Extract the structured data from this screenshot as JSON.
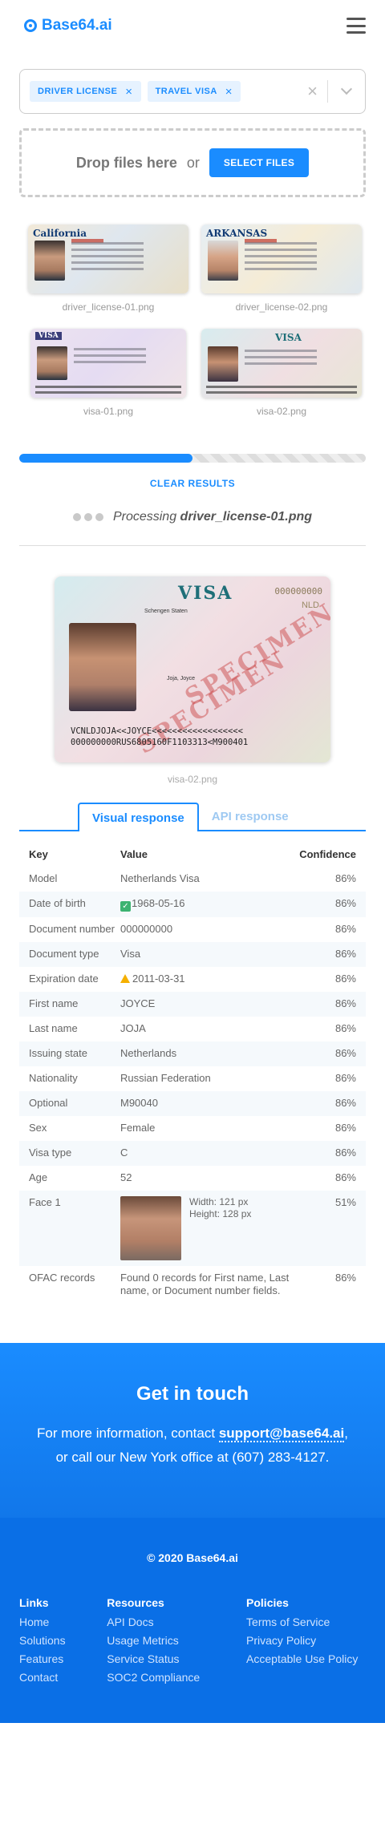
{
  "header": {
    "logo_text": "Base64.ai",
    "menu_icon": "hamburger-menu-icon"
  },
  "select": {
    "chips": [
      {
        "label": "DRIVER LICENSE"
      },
      {
        "label": "TRAVEL VISA"
      }
    ],
    "clear_symbol": "×",
    "chip_remove_symbol": "×"
  },
  "dropzone": {
    "text": "Drop files here",
    "or": "or",
    "button": "SELECT FILES"
  },
  "thumbnails": [
    {
      "caption": "driver_license-01.png",
      "header": "California"
    },
    {
      "caption": "driver_license-02.png",
      "header": "ARKANSAS"
    },
    {
      "caption": "visa-01.png",
      "header": "VISA"
    },
    {
      "caption": "visa-02.png",
      "header": "VISA"
    }
  ],
  "progress": {
    "fraction": 0.5
  },
  "clear_results": "CLEAR RESULTS",
  "processing": {
    "prefix": "Processing",
    "file": "driver_license-01.png"
  },
  "preview": {
    "caption": "visa-02.png",
    "title": "VISA",
    "number": "000000000",
    "country": "NLD",
    "field_1": "Schengen Staten",
    "field_2": "Joja, Joyce",
    "specimen": "SPECIMEN",
    "mrz_1": "VCNLDJOJA<<JOYCE<<<<<<<<<<<<<<<<<<",
    "mrz_2": "000000000RUS6805160F1103313<M900401"
  },
  "tabs": {
    "visual": "Visual response",
    "api": "API response"
  },
  "table": {
    "headers": {
      "key": "Key",
      "value": "Value",
      "confidence": "Confidence"
    },
    "rows": [
      {
        "key": "Model",
        "value": "Netherlands Visa",
        "confidence": "86%"
      },
      {
        "key": "Date of birth",
        "value": "1968-05-16",
        "confidence": "86%",
        "icon": "check"
      },
      {
        "key": "Document number",
        "value": "000000000",
        "confidence": "86%"
      },
      {
        "key": "Document type",
        "value": "Visa",
        "confidence": "86%"
      },
      {
        "key": "Expiration date",
        "value": "2011-03-31",
        "confidence": "86%",
        "icon": "warning"
      },
      {
        "key": "First name",
        "value": "JOYCE",
        "confidence": "86%"
      },
      {
        "key": "Last name",
        "value": "JOJA",
        "confidence": "86%"
      },
      {
        "key": "Issuing state",
        "value": "Netherlands",
        "confidence": "86%"
      },
      {
        "key": "Nationality",
        "value": "Russian Federation",
        "confidence": "86%"
      },
      {
        "key": "Optional",
        "value": "M90040",
        "confidence": "86%"
      },
      {
        "key": "Sex",
        "value": "Female",
        "confidence": "86%"
      },
      {
        "key": "Visa type",
        "value": "C",
        "confidence": "86%"
      },
      {
        "key": "Age",
        "value": "52",
        "confidence": "86%"
      },
      {
        "key": "Face 1",
        "width": "Width: 121 px",
        "height": "Height: 128 px",
        "confidence": "51%"
      },
      {
        "key": "OFAC records",
        "value": "Found 0 records for First name, Last name, or Document number fields.",
        "confidence": "86%"
      }
    ]
  },
  "contact": {
    "title": "Get in touch",
    "line1_prefix": "For more information, contact ",
    "email": "support@base64.ai",
    "line1_suffix": ",",
    "line2": "or call our New York office at (607) 283-4127."
  },
  "footer": {
    "copyright": "© 2020 Base64.ai",
    "columns": [
      {
        "title": "Links",
        "items": [
          "Home",
          "Solutions",
          "Features",
          "Contact"
        ]
      },
      {
        "title": "Resources",
        "items": [
          "API Docs",
          "Usage Metrics",
          "Service Status",
          "SOC2 Compliance"
        ]
      },
      {
        "title": "Policies",
        "items": [
          "Terms of Service",
          "Privacy Policy",
          "Acceptable Use Policy"
        ]
      }
    ]
  },
  "colors": {
    "accent": "#1a8cff",
    "success": "#3cb371",
    "warning": "#f5b000",
    "footer": "#0a6fe6"
  }
}
